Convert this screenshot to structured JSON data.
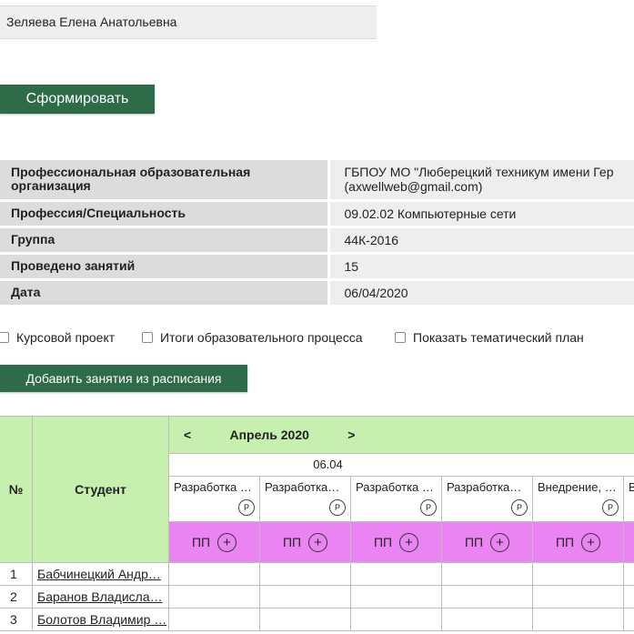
{
  "teacher": {
    "name": "Зеляева Елена Анатольевна"
  },
  "actions": {
    "generate_label": "Сформировать",
    "add_lessons_label": "Добавить занятия из расписания"
  },
  "info": [
    {
      "label": "Профессиональная образовательная организация",
      "value": "ГБПОУ МО \"Люберецкий техникум имени Гер\n(axwellweb@gmail.com)"
    },
    {
      "label": "Профессия/Специальность",
      "value": "09.02.02 Компьютерные сети"
    },
    {
      "label": "Группа",
      "value": "44К-2016"
    },
    {
      "label": "Проведено занятий",
      "value": "15"
    },
    {
      "label": "Дата",
      "value": "06/04/2020"
    }
  ],
  "options": [
    {
      "label": "Курсовой проект",
      "checked": false
    },
    {
      "label": "Итоги образовательного процесса",
      "checked": false
    },
    {
      "label": "Показать тематический план",
      "checked": false
    }
  ],
  "journal": {
    "num_header": "№",
    "student_header": "Студент",
    "prev": "<",
    "next": ">",
    "month": "Апрель 2020",
    "date": "06.04",
    "lessons": [
      {
        "title": "Разработка …",
        "badge": "Р"
      },
      {
        "title": "Разработка…",
        "badge": "Р"
      },
      {
        "title": "Разработка …",
        "badge": "Р"
      },
      {
        "title": "Разработка…",
        "badge": "Р"
      },
      {
        "title": "Внедрение, …",
        "badge": "Р"
      },
      {
        "title": "В",
        "badge": ""
      }
    ],
    "lesson_type": "ПП",
    "plus": "+",
    "students": [
      {
        "num": "1",
        "name": "Бабчинецкий Андр…"
      },
      {
        "num": "2",
        "name": "Баранов Владисла…"
      },
      {
        "num": "3",
        "name": "Болотов Владимир …"
      }
    ]
  }
}
